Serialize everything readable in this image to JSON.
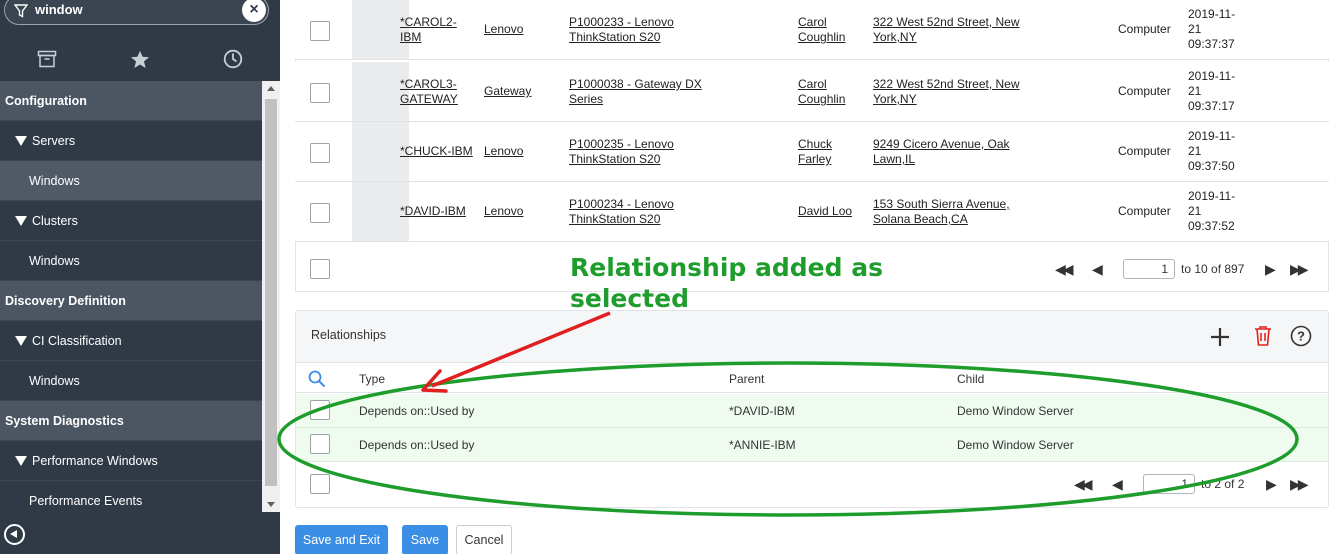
{
  "sidebar": {
    "filter_text": "window",
    "tabs": [
      {
        "icon": "archive-icon"
      },
      {
        "icon": "star-icon"
      },
      {
        "icon": "clock-icon"
      }
    ],
    "nav": [
      {
        "kind": "cat",
        "label": "Configuration"
      },
      {
        "kind": "mod",
        "label": "Servers"
      },
      {
        "kind": "sub",
        "label": "Windows",
        "active": true
      },
      {
        "kind": "mod",
        "label": "Clusters"
      },
      {
        "kind": "sub",
        "label": "Windows"
      },
      {
        "kind": "cat",
        "label": "Discovery Definition"
      },
      {
        "kind": "mod",
        "label": "CI Classification"
      },
      {
        "kind": "sub",
        "label": "Windows"
      },
      {
        "kind": "cat",
        "label": "System Diagnostics"
      },
      {
        "kind": "mod",
        "label": "Performance Windows"
      },
      {
        "kind": "sub",
        "label": "Performance Events"
      }
    ]
  },
  "ci_table": {
    "rows": [
      {
        "name": "*CAROL2-IBM",
        "name_lines": [
          "*CAROL2-",
          "IBM"
        ],
        "manufacturer": "Lenovo",
        "model_lines": [
          "P1000233 - Lenovo",
          "ThinkStation S20"
        ],
        "assigned_lines": [
          "Carol",
          "Coughlin"
        ],
        "location_lines": [
          "322 West 52nd Street, New",
          "York,NY"
        ],
        "class": "Computer",
        "updated_lines": [
          "2019-11-",
          "21",
          "09:37:37"
        ]
      },
      {
        "name": "*CAROL3-GATEWAY",
        "name_lines": [
          "*CAROL3-",
          "GATEWAY"
        ],
        "manufacturer": "Gateway",
        "model_lines": [
          "P1000038 - Gateway DX",
          "Series"
        ],
        "assigned_lines": [
          "Carol",
          "Coughlin"
        ],
        "location_lines": [
          "322 West 52nd Street, New",
          "York,NY"
        ],
        "class": "Computer",
        "updated_lines": [
          "2019-11-",
          "21",
          "09:37:17"
        ]
      },
      {
        "name": "*CHUCK-IBM",
        "name_lines": [
          "*CHUCK-IBM"
        ],
        "manufacturer": "Lenovo",
        "model_lines": [
          "P1000235 - Lenovo",
          "ThinkStation S20"
        ],
        "assigned_lines": [
          "Chuck",
          "Farley"
        ],
        "location_lines": [
          "9249 Cicero Avenue, Oak",
          "Lawn,IL"
        ],
        "class": "Computer",
        "updated_lines": [
          "2019-11-",
          "21",
          "09:37:50"
        ]
      },
      {
        "name": "*DAVID-IBM",
        "name_lines": [
          "*DAVID-IBM"
        ],
        "manufacturer": "Lenovo",
        "model_lines": [
          "P1000234 - Lenovo",
          "ThinkStation S20"
        ],
        "assigned_lines": [
          "David Loo"
        ],
        "location_lines": [
          "153 South Sierra Avenue,",
          "Solana Beach,CA"
        ],
        "class": "Computer",
        "updated_lines": [
          "2019-11-",
          "21",
          "09:37:52"
        ]
      }
    ],
    "pager": {
      "page_value": "1",
      "range_text": "to 10 of 897"
    }
  },
  "annotation": {
    "line1": "Relationship added as",
    "line2": "selected",
    "color": "#1e9d2d"
  },
  "relationships": {
    "title": "Relationships",
    "columns": {
      "type": "Type",
      "parent": "Parent",
      "child": "Child"
    },
    "rows": [
      {
        "type": "Depends on::Used by",
        "parent": "*DAVID-IBM",
        "child": "Demo Window Server"
      },
      {
        "type": "Depends on::Used by",
        "parent": "*ANNIE-IBM",
        "child": "Demo Window Server"
      }
    ],
    "pager": {
      "page_value": "1",
      "range_text": "to 2 of 2"
    }
  },
  "actions": {
    "save_exit": "Save and Exit",
    "save": "Save",
    "cancel": "Cancel"
  },
  "colors": {
    "sidebar_bg": "#303a46",
    "primary": "#3b8ee5",
    "delete": "#e2231a",
    "highlight_green": "#1e9d2d",
    "arrow_red": "#e02020"
  }
}
